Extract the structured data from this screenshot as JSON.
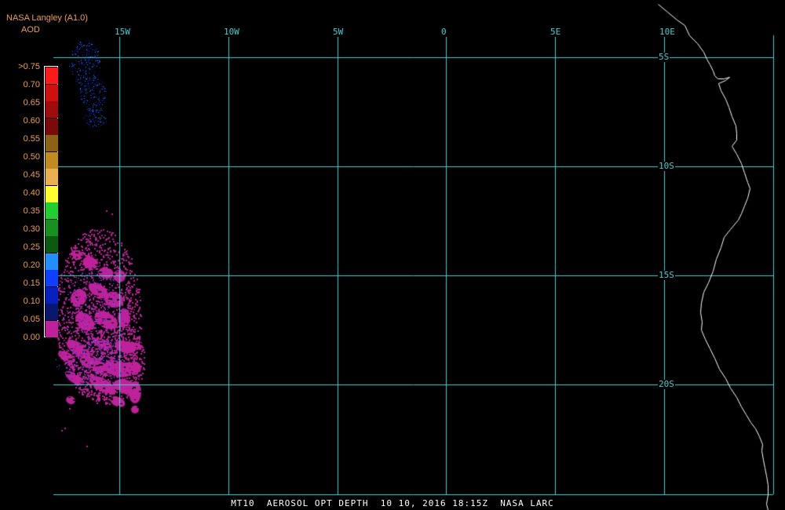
{
  "header": {
    "product": "NASA Langley (A1.0)",
    "variable": "AOD"
  },
  "legend": {
    "labels": [
      ">0.75",
      "0.70",
      "0.65",
      "0.60",
      "0.55",
      "0.50",
      "0.45",
      "0.40",
      "0.35",
      "0.30",
      "0.25",
      "0.20",
      "0.15",
      "0.10",
      "0.05",
      "0.00"
    ],
    "colors": [
      "#ff1a1a",
      "#d01010",
      "#a00c0c",
      "#7c0a0a",
      "#8a6414",
      "#c08c20",
      "#e8b050",
      "#ffff30",
      "#20d030",
      "#189020",
      "#0c5a10",
      "#2090ff",
      "#1040ff",
      "#0820c0",
      "#081870",
      "#c0209c"
    ]
  },
  "map": {
    "longitude_labels": [
      "15W",
      "10W",
      "5W",
      "0",
      "5E",
      "10E"
    ],
    "latitude_labels": [
      "5S",
      "10S",
      "15S",
      "20S"
    ],
    "grid_color": "#40d0d0",
    "coast_color": "#ffffff",
    "background": "#000000"
  },
  "footer": {
    "text": "MT10  AEROSOL OPT DEPTH  10 10, 2016 18:15Z  NASA LARC"
  }
}
